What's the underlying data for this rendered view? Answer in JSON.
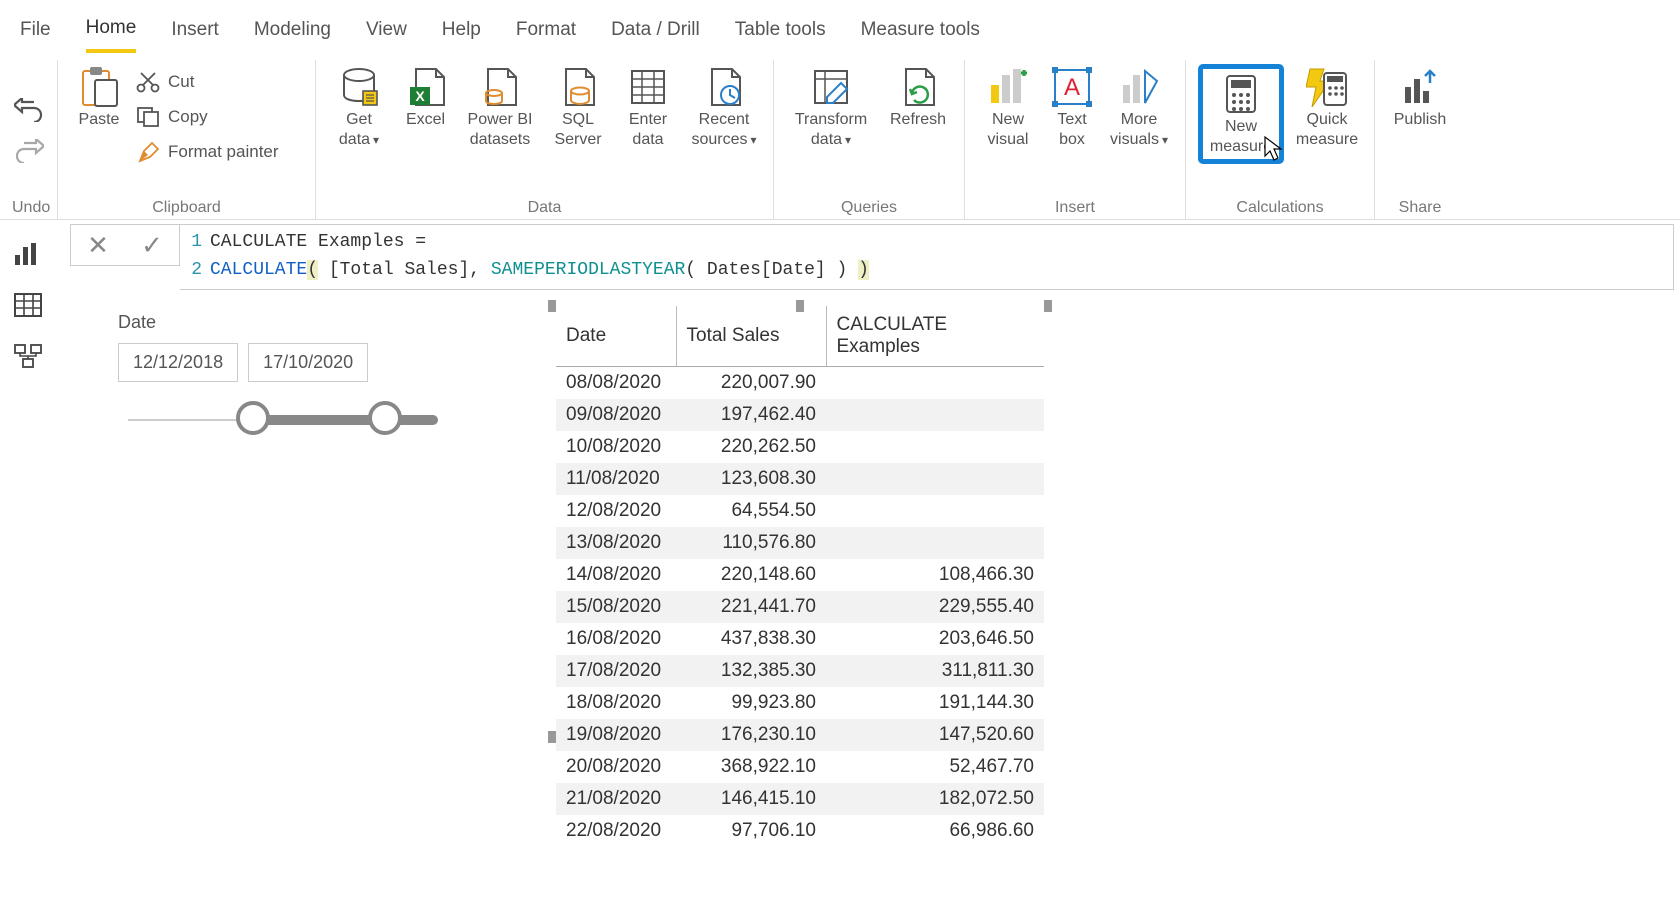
{
  "menubar": {
    "tabs": [
      "File",
      "Home",
      "Insert",
      "Modeling",
      "View",
      "Help",
      "Format",
      "Data / Drill",
      "Table tools",
      "Measure tools"
    ],
    "active": "Home"
  },
  "ribbon": {
    "undo_group": {
      "label": "Undo"
    },
    "clipboard": {
      "label": "Clipboard",
      "paste": "Paste",
      "cut": "Cut",
      "copy": "Copy",
      "format_painter": "Format painter"
    },
    "data": {
      "label": "Data",
      "get_data": "Get data",
      "excel": "Excel",
      "powerbi_ds": "Power BI datasets",
      "sql": "SQL Server",
      "enter_data": "Enter data",
      "recent": "Recent sources"
    },
    "queries": {
      "label": "Queries",
      "transform": "Transform data",
      "refresh": "Refresh"
    },
    "insert": {
      "label": "Insert",
      "new_visual": "New visual",
      "text_box": "Text box",
      "more_visuals": "More visuals"
    },
    "calculations": {
      "label": "Calculations",
      "new_measure": "New measure",
      "quick_measure": "Quick measure"
    },
    "share": {
      "label": "Share",
      "publish": "Publish"
    }
  },
  "formula": {
    "line1": "CALCULATE Examples =",
    "line2": {
      "fn1": "CALCULATE",
      "p1": "(",
      "arg1": " [Total Sales], ",
      "fn2": "SAMEPERIODLASTYEAR",
      "p2": "(",
      "arg2": " Dates[Date] ",
      "p3": ")",
      "sp": " ",
      "p4": ")"
    }
  },
  "slicer": {
    "title": "Date",
    "from": "12/12/2018",
    "to": "17/10/2020"
  },
  "table": {
    "columns": [
      "Date",
      "Total Sales",
      "CALCULATE Examples"
    ],
    "rows": [
      {
        "date": "08/08/2020",
        "total": "220,007.90",
        "calc": ""
      },
      {
        "date": "09/08/2020",
        "total": "197,462.40",
        "calc": ""
      },
      {
        "date": "10/08/2020",
        "total": "220,262.50",
        "calc": ""
      },
      {
        "date": "11/08/2020",
        "total": "123,608.30",
        "calc": ""
      },
      {
        "date": "12/08/2020",
        "total": "64,554.50",
        "calc": ""
      },
      {
        "date": "13/08/2020",
        "total": "110,576.80",
        "calc": ""
      },
      {
        "date": "14/08/2020",
        "total": "220,148.60",
        "calc": "108,466.30"
      },
      {
        "date": "15/08/2020",
        "total": "221,441.70",
        "calc": "229,555.40"
      },
      {
        "date": "16/08/2020",
        "total": "437,838.30",
        "calc": "203,646.50"
      },
      {
        "date": "17/08/2020",
        "total": "132,385.30",
        "calc": "311,811.30"
      },
      {
        "date": "18/08/2020",
        "total": "99,923.80",
        "calc": "191,144.30"
      },
      {
        "date": "19/08/2020",
        "total": "176,230.10",
        "calc": "147,520.60"
      },
      {
        "date": "20/08/2020",
        "total": "368,922.10",
        "calc": "52,467.70"
      },
      {
        "date": "21/08/2020",
        "total": "146,415.10",
        "calc": "182,072.50"
      },
      {
        "date": "22/08/2020",
        "total": "97,706.10",
        "calc": "66,986.60"
      }
    ]
  }
}
